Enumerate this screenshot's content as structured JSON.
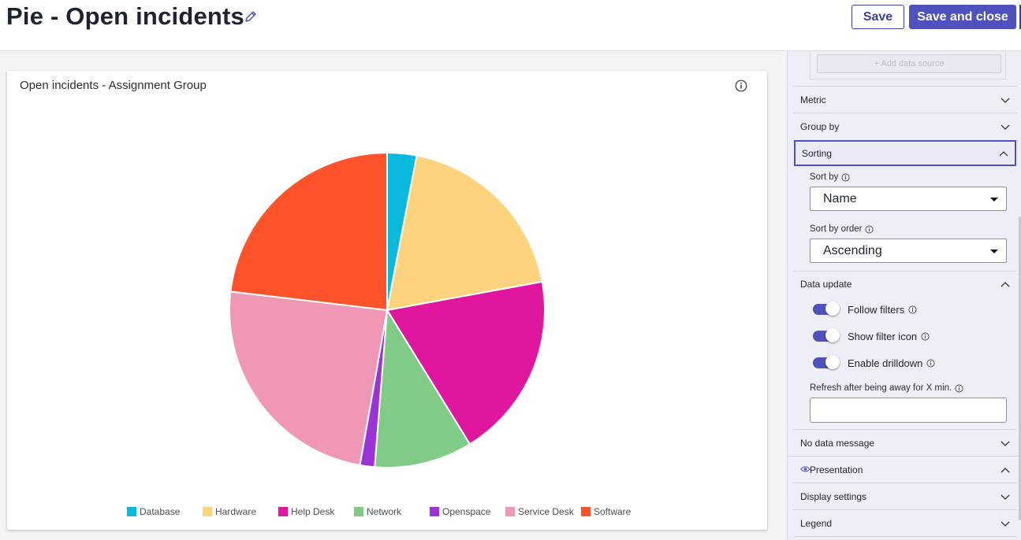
{
  "header": {
    "title": "Pie - Open incidents",
    "save_label": "Save",
    "save_close_label": "Save and close"
  },
  "card": {
    "title": "Open incidents - Assignment Group"
  },
  "chart_data": {
    "type": "pie",
    "categories": [
      "Database",
      "Hardware",
      "Help Desk",
      "Network",
      "Openspace",
      "Service Desk",
      "Software"
    ],
    "values": [
      3,
      19,
      19,
      10,
      1.5,
      24,
      23
    ],
    "colors": [
      "#0bb9dc",
      "#fdd47d",
      "#e0179e",
      "#7fcb87",
      "#9a34d6",
      "#ef97b5",
      "#ff542b"
    ],
    "title": "Open incidents - Assignment Group",
    "legend": "bottom"
  },
  "panel": {
    "add_data_source": "+ Add data source",
    "sections": {
      "metric": "Metric",
      "group_by": "Group by",
      "sorting": "Sorting",
      "data_update": "Data update",
      "no_data_message": "No data message",
      "presentation": "Presentation",
      "display_settings": "Display settings",
      "legend": "Legend"
    },
    "sorting": {
      "sort_by_label": "Sort by",
      "sort_by_value": "Name",
      "sort_order_label": "Sort by order",
      "sort_order_value": "Ascending"
    },
    "data_update": {
      "follow_filters": "Follow filters",
      "show_filter_icon": "Show filter icon",
      "enable_drilldown": "Enable drilldown",
      "refresh_label": "Refresh after being away for X min.",
      "refresh_value": ""
    },
    "icons": {
      "edit": "pencil-icon",
      "info": "info-icon",
      "chevron": "chevron-icon",
      "presentation": "eye-icon"
    }
  }
}
